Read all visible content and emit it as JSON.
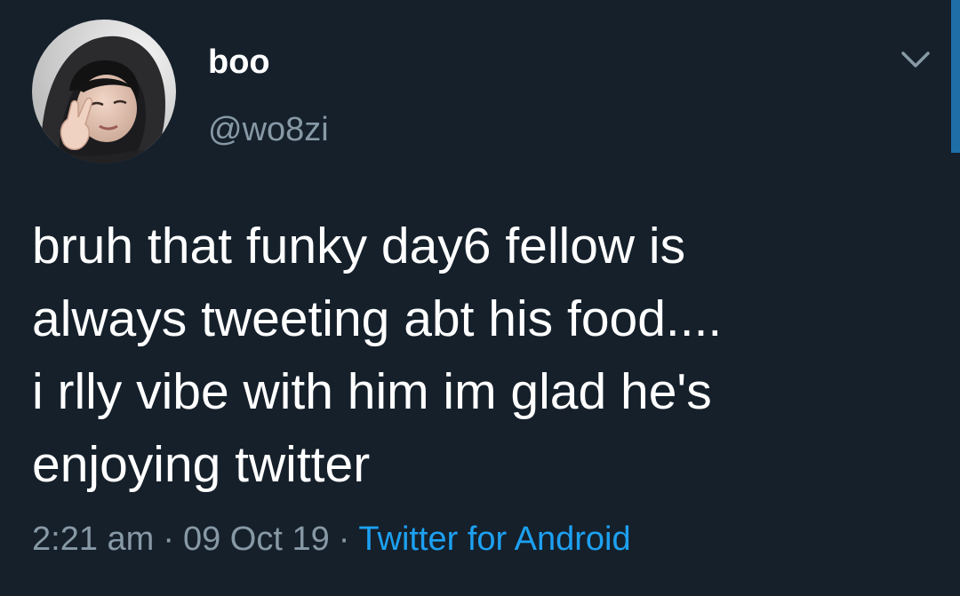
{
  "tweet": {
    "author": {
      "display_name": "boo",
      "handle": "@wo8zi"
    },
    "text_lines": [
      "bruh that funky day6 fellow is",
      "always tweeting abt his food....",
      "i rlly vibe with him im glad he's",
      "enjoying twitter"
    ],
    "time": "2:21 am",
    "date": "09 Oct 19",
    "separator": "·",
    "source": "Twitter for Android"
  },
  "colors": {
    "background": "#15202b",
    "primary_text": "#ffffff",
    "secondary_text": "#8899a6",
    "link": "#1da1f2",
    "scroll_indicator": "#1f6ea8"
  },
  "icons": {
    "menu": "chevron-down-icon",
    "avatar": "user-avatar-photo"
  }
}
